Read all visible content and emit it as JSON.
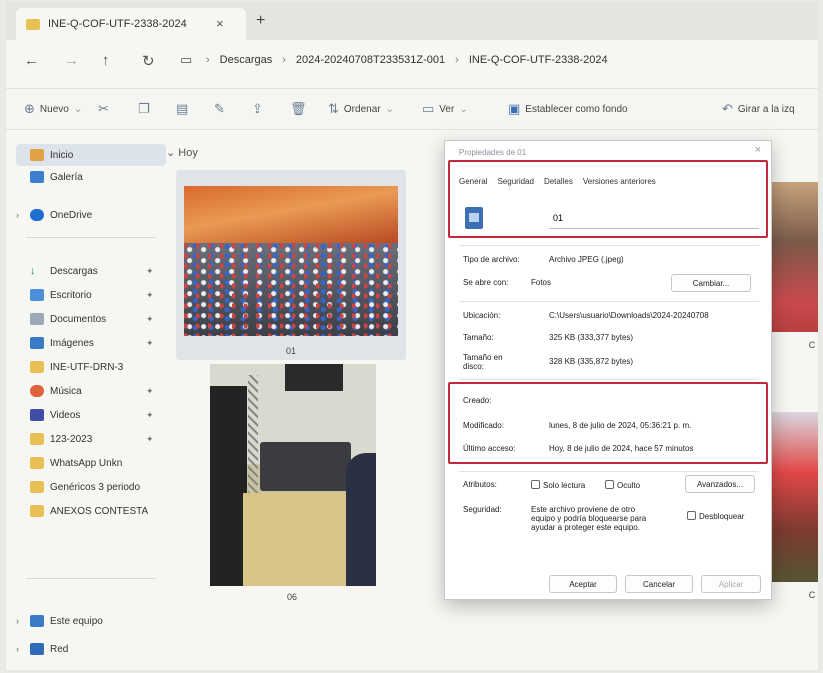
{
  "tab": {
    "title": "INE-Q-COF-UTF-2338-2024",
    "close": "×",
    "new": "+"
  },
  "address": {
    "crumbs": [
      "Descargas",
      "2024-20240708T233531Z-001",
      "INE-Q-COF-UTF-2338-2024"
    ],
    "sep": "›"
  },
  "toolbar": {
    "new": "Nuevo",
    "sort": "Ordenar",
    "view": "Ver",
    "set_background": "Establecer como fondo",
    "rotate": "Girar a la izq"
  },
  "sidebar": {
    "items": [
      {
        "label": "Inicio"
      },
      {
        "label": "Galería"
      },
      {
        "label": "OneDrive"
      },
      {
        "label": "Descargas"
      },
      {
        "label": "Escritorio"
      },
      {
        "label": "Documentos"
      },
      {
        "label": "Imágenes"
      },
      {
        "label": "INE-UTF-DRN-3"
      },
      {
        "label": "Música"
      },
      {
        "label": "Videos"
      },
      {
        "label": "123-2023"
      },
      {
        "label": "WhatsApp Unkn"
      },
      {
        "label": "Genéricos 3 periodo"
      },
      {
        "label": "ANEXOS CONTESTA"
      },
      {
        "label": "Este equipo"
      },
      {
        "label": "Red"
      }
    ]
  },
  "content": {
    "group": "Hoy",
    "files": [
      {
        "name": "01"
      },
      {
        "name": "06"
      }
    ],
    "edge_captions": [
      "C",
      "C",
      "C"
    ]
  },
  "dialog": {
    "title": "Propiedades de 01",
    "close": "×",
    "tabs": [
      "General",
      "Seguridad",
      "Detalles",
      "Versiones anteriores"
    ],
    "filename": "01",
    "type_label": "Tipo de archivo:",
    "type_value": "Archivo JPEG (.jpeg)",
    "opens_label": "Se abre con:",
    "opens_value": "Fotos",
    "change_btn": "Cambiar...",
    "location_label": "Ubicación:",
    "location_value": "C:\\Users\\usuario\\Downloads\\2024-20240708",
    "size_label": "Tamaño:",
    "size_value": "325 KB (333,377 bytes)",
    "disk_label_1": "Tamaño en",
    "disk_label_2": "disco:",
    "disk_value": "328 KB (335,872 bytes)",
    "created_label": "Creado:",
    "created_value": "",
    "modified_label": "Modificado:",
    "modified_value": "lunes, 8 de julio de 2024, 05:36:21 p. m.",
    "accessed_label": "Último acceso:",
    "accessed_value": "Hoy, 8 de julio de 2024, hace 57 minutos",
    "attrs_label": "Atributos:",
    "readonly": "Solo lectura",
    "hidden": "Oculto",
    "advanced_btn": "Avanzados...",
    "security_label": "Seguridad:",
    "security_text_1": "Este archivo proviene de otro",
    "security_text_2": "equipo y podría bloquearse para",
    "security_text_3": "ayudar a proteger este equipo.",
    "unblock": "Desbloquear",
    "ok": "Aceptar",
    "cancel": "Cancelar",
    "apply": "Aplicar"
  }
}
